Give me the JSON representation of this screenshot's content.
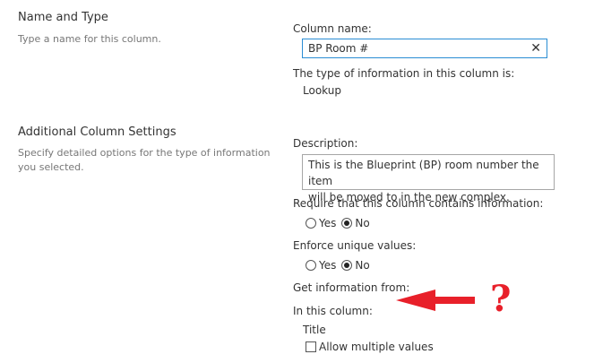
{
  "sections": {
    "name_type": {
      "title": "Name and Type",
      "description": "Type a name for this column."
    },
    "additional": {
      "title": "Additional Column Settings",
      "description_line1": "Specify detailed options for the type of information",
      "description_line2": "you selected."
    }
  },
  "column_name": {
    "label": "Column name:",
    "value": "BP Room #",
    "clear_glyph": "✕"
  },
  "type_info": {
    "label": "The type of information in this column is:",
    "value": "Lookup"
  },
  "description": {
    "label": "Description:",
    "line1": "This is the Blueprint (BP) room number the item",
    "line2": "will be moved to in the new complex."
  },
  "require": {
    "label": "Require that this column contains information:",
    "options": [
      {
        "label": "Yes",
        "checked": false
      },
      {
        "label": "No",
        "checked": true
      }
    ]
  },
  "unique": {
    "label": "Enforce unique values:",
    "options": [
      {
        "label": "Yes",
        "checked": false
      },
      {
        "label": "No",
        "checked": true
      }
    ]
  },
  "get_info": {
    "label": "Get information from:"
  },
  "in_column": {
    "label": "In this column:",
    "value": "Title"
  },
  "multiple": {
    "label": "Allow multiple values",
    "checked": false
  },
  "annotation": {
    "question": "?",
    "color": "#e8202a",
    "icon": "left-arrow-icon"
  },
  "colors": {
    "input_border": "#2a8dd4",
    "text": "#333333",
    "muted": "#777777"
  }
}
